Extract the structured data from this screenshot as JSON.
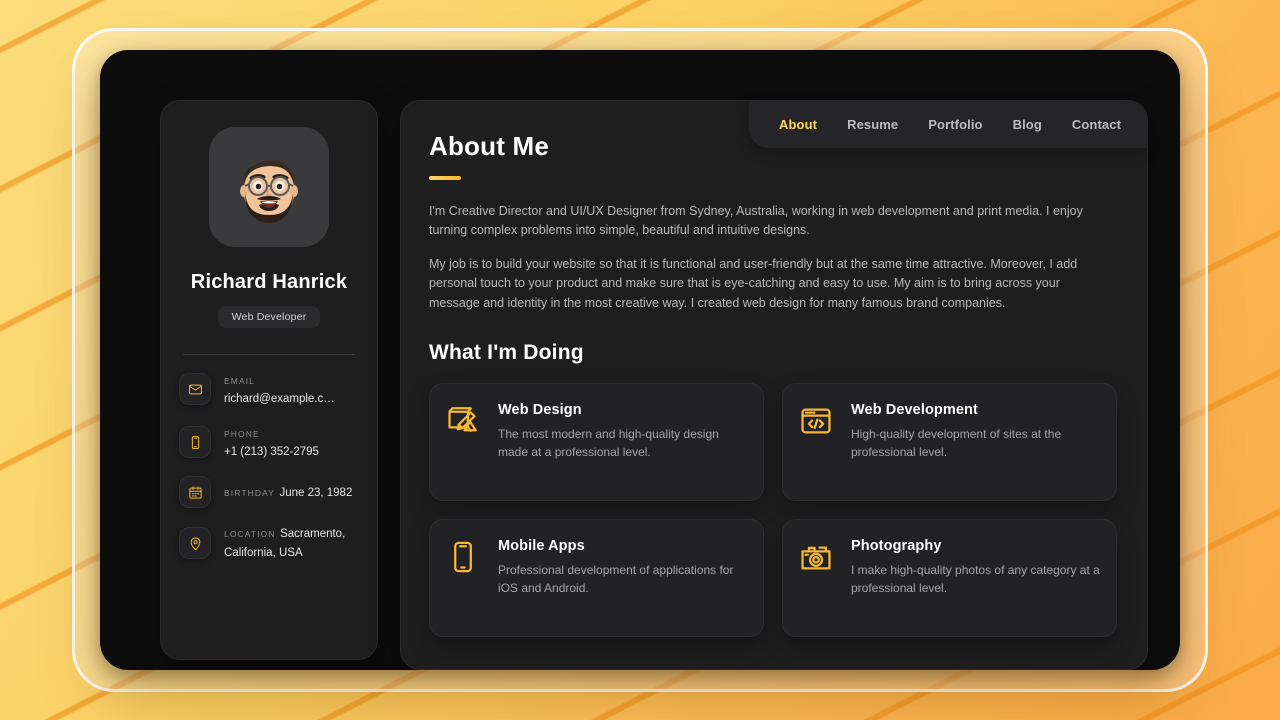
{
  "theme": {
    "accent": "#FFD566",
    "accent_dark": "#F7B733",
    "background_yellow": "#FBD462",
    "stripe_orange": "#F08E1A",
    "panel": "#1E1E1F",
    "card": "#222224",
    "device": "#0d0d0d"
  },
  "sidebar": {
    "avatar_alt": "memoji-avatar",
    "name": "Richard Hanrick",
    "title": "Web Developer",
    "contacts": [
      {
        "icon": "mail-icon",
        "label": "EMAIL",
        "value": "richard@example.c…",
        "multiline": false
      },
      {
        "icon": "phone-icon",
        "label": "PHONE",
        "value": "+1 (213) 352-2795",
        "multiline": false
      },
      {
        "icon": "calendar-icon",
        "label": "BIRTHDAY",
        "value": "June 23, 1982",
        "multiline": false
      },
      {
        "icon": "location-icon",
        "label": "LOCATION",
        "value": "Sacramento, California, USA",
        "multiline": true
      }
    ]
  },
  "navbar": {
    "items": [
      {
        "label": "About",
        "active": true
      },
      {
        "label": "Resume",
        "active": false
      },
      {
        "label": "Portfolio",
        "active": false
      },
      {
        "label": "Blog",
        "active": false
      },
      {
        "label": "Contact",
        "active": false
      }
    ]
  },
  "main": {
    "page_title": "About Me",
    "paragraphs": [
      "I'm Creative Director and UI/UX Designer from Sydney, Australia, working in web development and print media. I enjoy turning complex problems into simple, beautiful and intuitive designs.",
      "My job is to build your website so that it is functional and user-friendly but at the same time attractive. Moreover, I add personal touch to your product and make sure that is eye-catching and easy to use. My aim is to bring across your message and identity in the most creative way. I created web design for many famous brand companies."
    ],
    "section_title": "What I'm Doing",
    "services": [
      {
        "icon": "design-board-icon",
        "title": "Web Design",
        "desc": "The most modern and high-quality design made at a professional level."
      },
      {
        "icon": "code-window-icon",
        "title": "Web Development",
        "desc": "High-quality development of sites at the professional level."
      },
      {
        "icon": "mobile-phone-icon",
        "title": "Mobile Apps",
        "desc": "Professional development of applications for iOS and Android."
      },
      {
        "icon": "camera-icon",
        "title": "Photography",
        "desc": "I make high-quality photos of any category at a professional level."
      }
    ]
  }
}
